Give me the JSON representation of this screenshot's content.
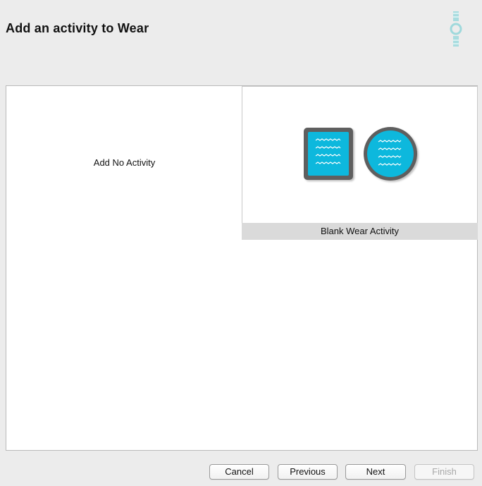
{
  "header": {
    "title": "Add an activity to Wear",
    "logo_icon": "android-wear-icon"
  },
  "gallery": {
    "items": [
      {
        "label": "Add No Activity",
        "selected": false
      },
      {
        "label": "Blank Wear Activity",
        "selected": true
      }
    ]
  },
  "buttons": {
    "cancel": "Cancel",
    "previous": "Previous",
    "next": "Next",
    "finish": "Finish"
  },
  "colors": {
    "accent": "#0bb8dd",
    "bezel": "#5f5f5f",
    "logo": "#9fd9dc",
    "selected_caption_bg": "#dadada"
  }
}
